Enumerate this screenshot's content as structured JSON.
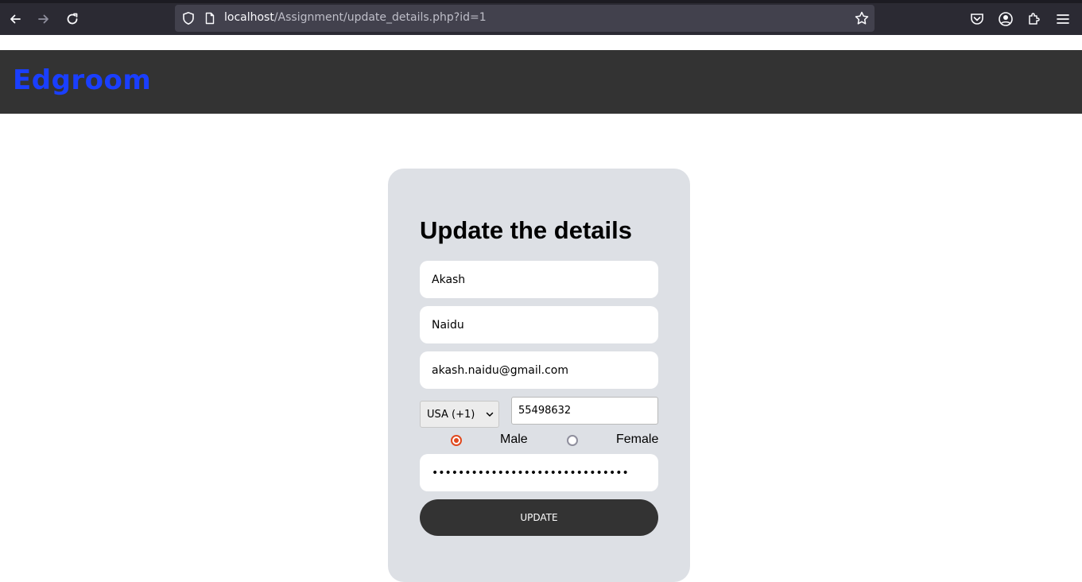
{
  "browser": {
    "url_host": "localhost",
    "url_path": "/Assignment/update_details.php?id=1"
  },
  "site": {
    "logo": "Edgroom"
  },
  "form": {
    "title": "Update the details",
    "first_name": "Akash",
    "last_name": "Naidu",
    "email": "akash.naidu@gmail.com",
    "country_code": "USA (+1)",
    "phone": "55498632",
    "gender_options": [
      "Male",
      "Female"
    ],
    "gender_selected": "Male",
    "password_masked": "••••••••••••••••••••••••••••••",
    "submit_label": "UPDATE"
  },
  "colors": {
    "logo": "#1a3fff",
    "header_bg": "#333333",
    "card_bg": "#dde0e5",
    "radio_accent": "#e0491e"
  }
}
